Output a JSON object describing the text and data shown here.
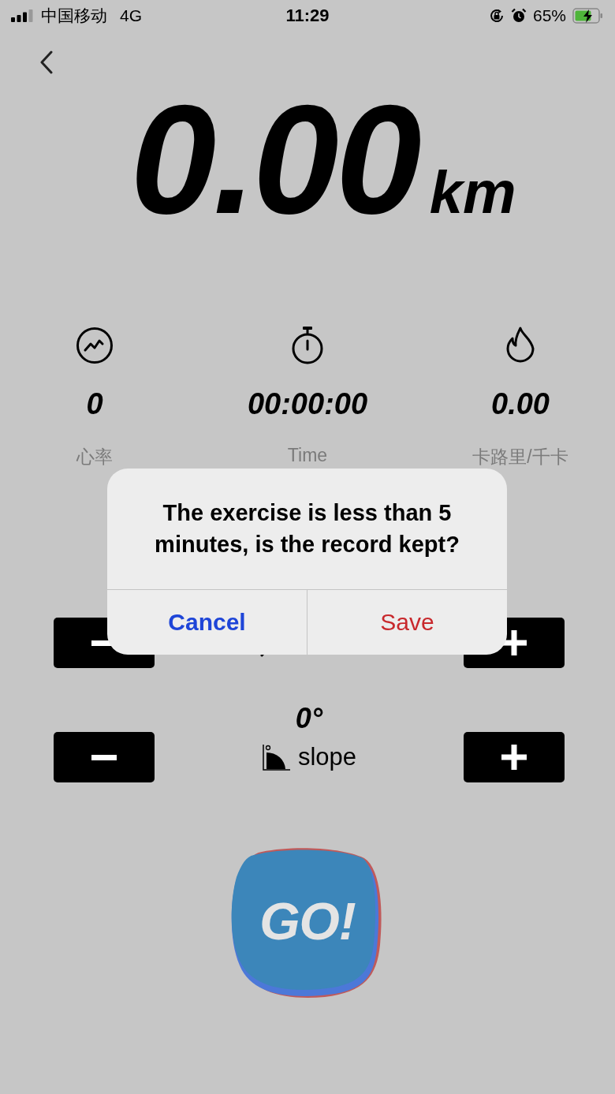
{
  "status_bar": {
    "carrier": "中国移动",
    "network": "4G",
    "time": "11:29",
    "battery": "65%"
  },
  "distance": {
    "value": "0.00",
    "unit": "km"
  },
  "stats": [
    {
      "kind": "heart_rate",
      "value": "0",
      "label": "心率"
    },
    {
      "kind": "time",
      "value": "00:00:00",
      "label": "Time"
    },
    {
      "kind": "calories",
      "value": "0.00",
      "label": "卡路里/千卡"
    }
  ],
  "controls": [
    {
      "kind": "speed"
    },
    {
      "kind": "slope",
      "value": "0°",
      "label": "slope"
    }
  ],
  "go_button": {
    "label": "GO!"
  },
  "dialog": {
    "message": "The exercise is less than 5 minutes, is the record kept?",
    "buttons": [
      {
        "kind": "cancel",
        "label": "Cancel"
      },
      {
        "kind": "save",
        "label": "Save"
      }
    ]
  }
}
